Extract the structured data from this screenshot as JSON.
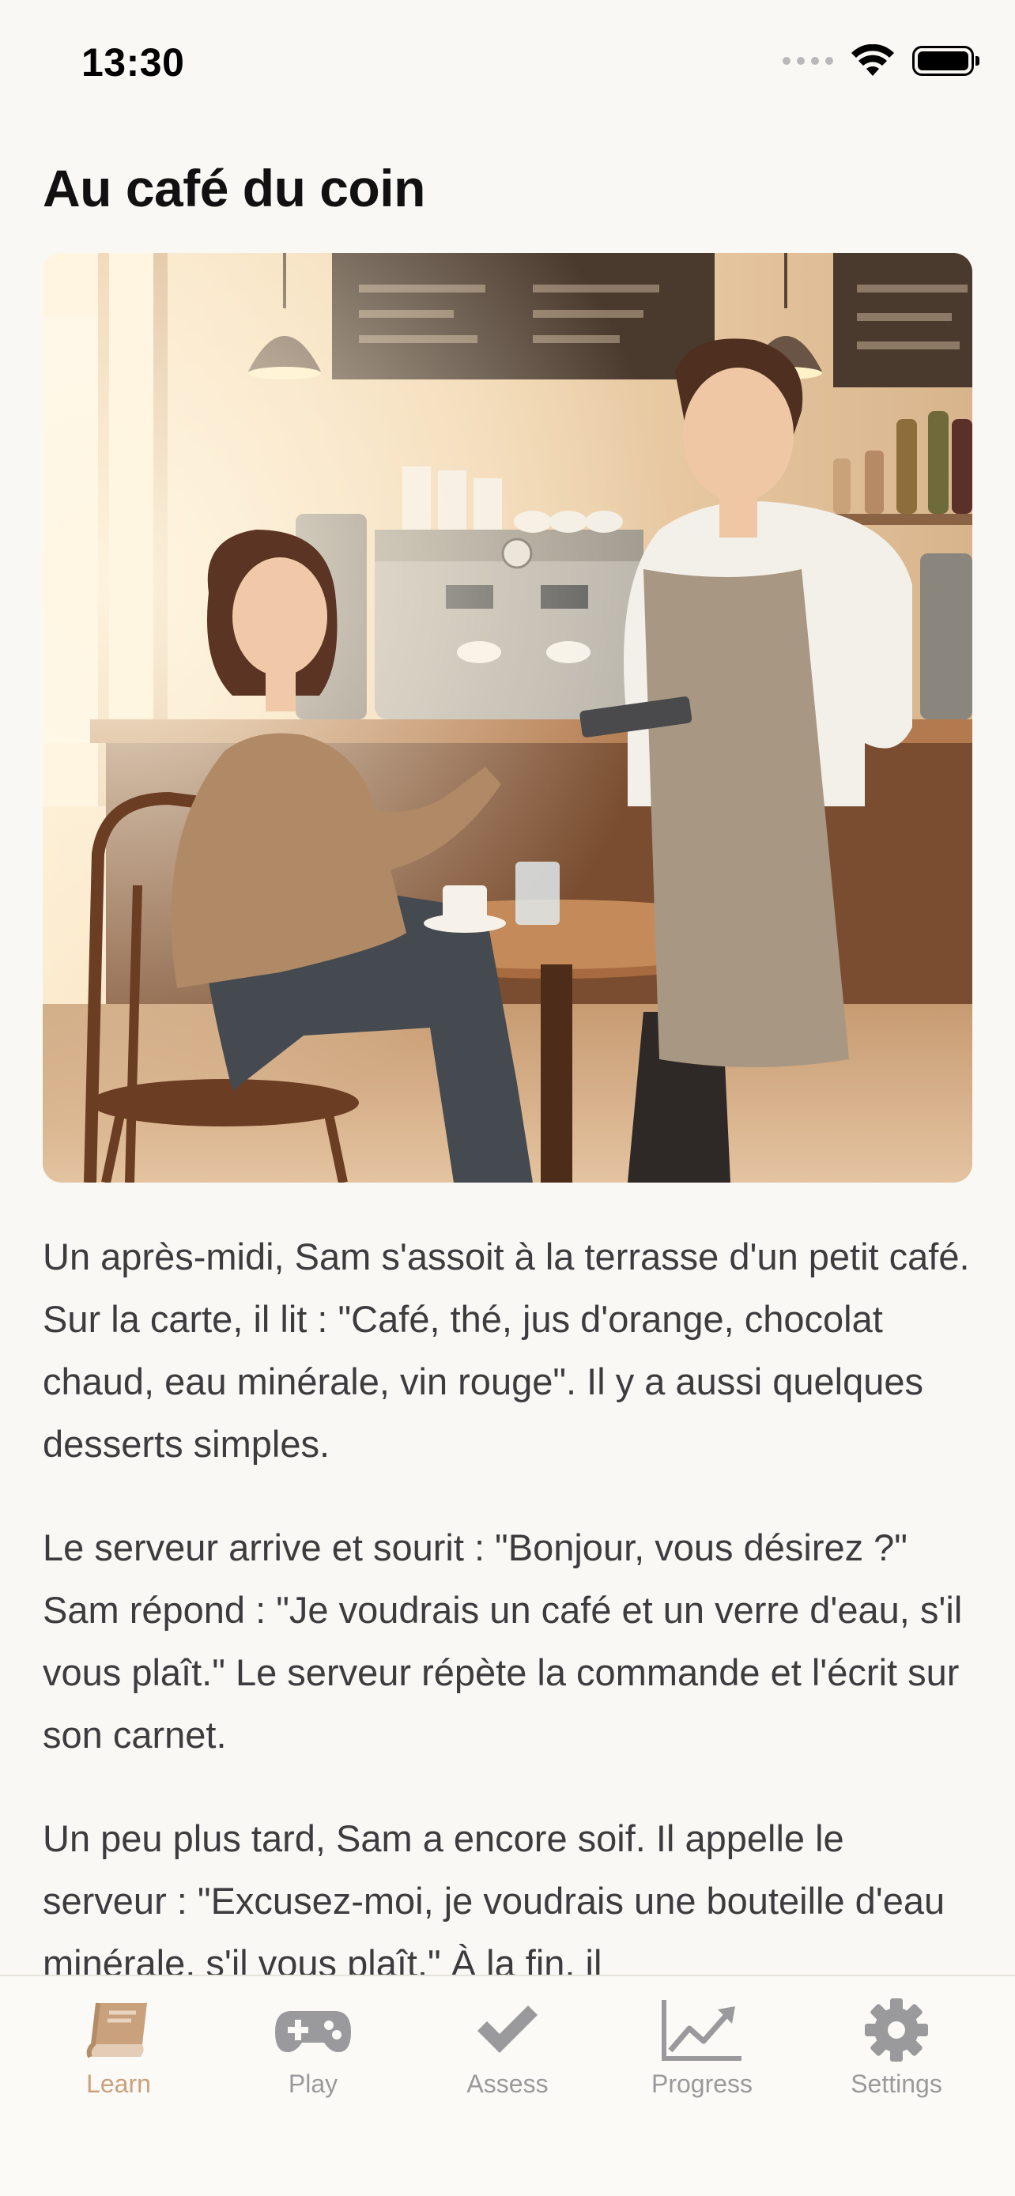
{
  "status_bar": {
    "time": "13:30"
  },
  "story": {
    "title": "Au café du coin",
    "paragraphs": [
      "Un après-midi, Sam s'assoit à la terrasse d'un petit café. Sur la carte, il lit : \"Café, thé, jus d'orange, chocolat chaud, eau minérale, vin rouge\". Il y a aussi quelques desserts simples.",
      "Le serveur arrive et sourit : \"Bonjour, vous désirez ?\" Sam répond : \"Je voudrais un café et un verre d'eau, s'il vous plaît.\" Le serveur répète la commande et l'écrit sur son carnet.",
      "Un peu plus tard, Sam a encore soif. Il appelle le serveur : \"Excusez-moi, je voudrais une bouteille d'eau minérale, s'il vous plaît.\" À la fin, il"
    ]
  },
  "tab_bar": {
    "tabs": [
      {
        "label": "Learn",
        "icon": "book-icon",
        "active": true
      },
      {
        "label": "Play",
        "icon": "gamepad-icon",
        "active": false
      },
      {
        "label": "Assess",
        "icon": "checkmark-icon",
        "active": false
      },
      {
        "label": "Progress",
        "icon": "chart-icon",
        "active": false
      },
      {
        "label": "Settings",
        "icon": "gear-icon",
        "active": false
      }
    ]
  },
  "colors": {
    "accent": "#c9a17c",
    "inactive": "#9a9a9c",
    "background": "#faf8f4"
  }
}
